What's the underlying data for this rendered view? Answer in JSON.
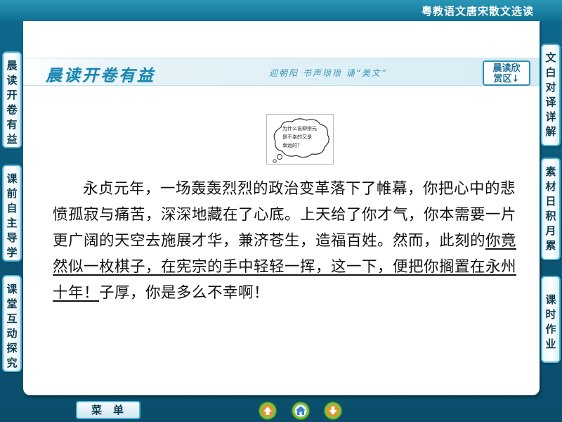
{
  "header": {
    "book_title": "粤教语文唐宋散文选读"
  },
  "banner": {
    "title": "晨读开卷有益",
    "subtitle": "迎朝阳  书声琅琅  诵“美文”",
    "badge_line1": "晨读欣",
    "badge_line2": "赏区↓"
  },
  "thought_bubble": {
    "icon": "thought-cloud-icon",
    "lines": [
      "为什么说柳宗元",
      "是不幸的又是",
      "幸运的？"
    ]
  },
  "passage": {
    "part1": "永贞元年，一场轰轰烈烈的政治变革落下了帷幕，你把心中的悲愤孤寂与痛苦，深深地藏在了心底。上天给了你才气，你本需要一片更广阔的天空去施展才华，兼济苍生，造福百姓。然而，此刻的",
    "underlined": "你竟然似一枚棋子，在宪宗的手中轻轻一挥，这一下，便把你搁置在永州十年！",
    "part2": "子厚，你是多么不幸啊！"
  },
  "left_tabs": [
    {
      "label": "晨读开卷有益"
    },
    {
      "label": "课前自主导学"
    },
    {
      "label": "课堂互动探究"
    }
  ],
  "right_tabs": [
    {
      "label": "文白对译详解"
    },
    {
      "label": "素材日积月累"
    },
    {
      "label": "课时作业"
    }
  ],
  "bottom_bar": {
    "menu_label": "菜单",
    "buttons": [
      {
        "icon": "previous-arrow-icon",
        "color": "#e8902a"
      },
      {
        "icon": "home-icon",
        "color": "#3b7fd0"
      },
      {
        "icon": "next-arrow-icon",
        "color": "#e8902a"
      }
    ]
  },
  "colors": {
    "background": "#0b5878",
    "accent": "#1a85b0",
    "tab_border": "#4fb0d3"
  }
}
